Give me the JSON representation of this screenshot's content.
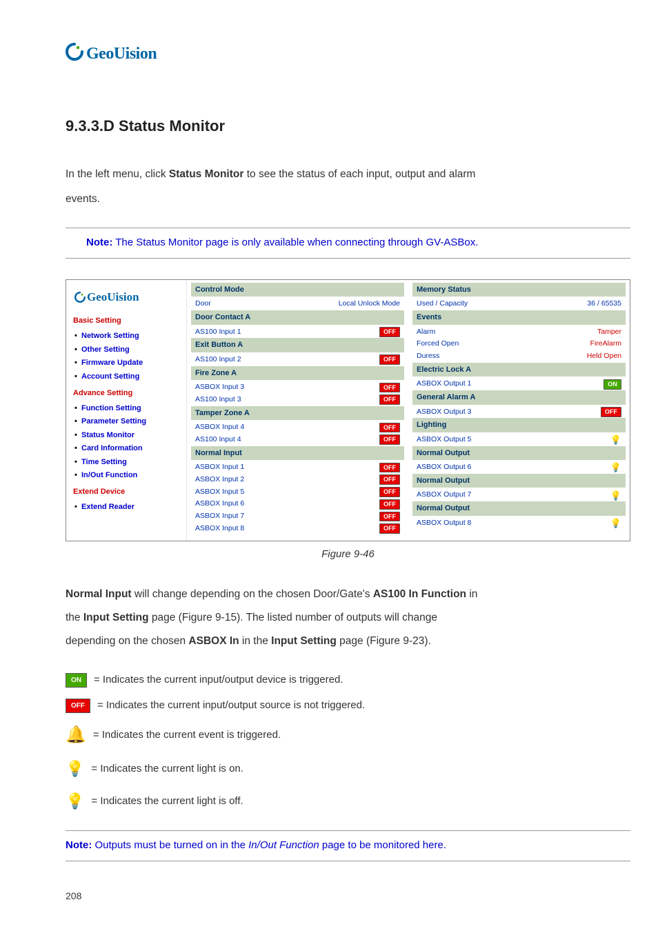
{
  "brand": "GeoUision",
  "section_title": "9.3.3.D  Status Monitor",
  "intro": {
    "t1": "In the left menu, click ",
    "b1": "Status Monitor",
    "t2": " to see the status of each input, output and alarm",
    "t3": "events."
  },
  "note1": {
    "b": "Note:",
    "body": " The Status Monitor page is only available when connecting through GV-ASBox."
  },
  "shot": {
    "brand": "GeoUision",
    "cats": {
      "basic": "Basic Setting",
      "advance": "Advance Setting",
      "extend": "Extend Device"
    },
    "menu_basic": [
      "Network Setting",
      "Other Setting",
      "Firmware Update",
      "Account Setting"
    ],
    "menu_adv": [
      "Function Setting",
      "Parameter Setting",
      "Status Monitor",
      "Card Information",
      "Time Setting",
      "In/Out Function"
    ],
    "menu_ext": [
      "Extend Reader"
    ],
    "left_col": {
      "h1": "Control Mode",
      "r1": {
        "k": "Door",
        "v": "Local Unlock Mode"
      },
      "h2": "Door Contact A",
      "r2": {
        "k": "AS100 Input 1",
        "v": "OFF"
      },
      "h3": "Exit Button A",
      "r3": {
        "k": "AS100 Input 2",
        "v": "OFF"
      },
      "h4": "Fire Zone A",
      "r4": {
        "k": "ASBOX Input 3",
        "v": "OFF"
      },
      "r5": {
        "k": "AS100 Input 3",
        "v": "OFF"
      },
      "h5": "Tamper Zone A",
      "r6": {
        "k": "ASBOX Input 4",
        "v": "OFF"
      },
      "r7": {
        "k": "AS100 Input 4",
        "v": "OFF"
      },
      "h6": "Normal Input",
      "r8": {
        "k": "ASBOX Input 1",
        "v": "OFF"
      },
      "r9": {
        "k": "ASBOX Input 2",
        "v": "OFF"
      },
      "r10": {
        "k": "ASBOX Input 5",
        "v": "OFF"
      },
      "r11": {
        "k": "ASBOX Input 6",
        "v": "OFF"
      },
      "r12": {
        "k": "ASBOX Input 7",
        "v": "OFF"
      },
      "r13": {
        "k": "ASBOX Input 8",
        "v": "OFF"
      }
    },
    "right_col": {
      "h1": "Memory Status",
      "r1": {
        "k": "Used / Capacity",
        "v": "36 / 65535"
      },
      "h2": "Events",
      "r2a": {
        "k": "Alarm",
        "v": "Tamper"
      },
      "r2b": {
        "k": "Forced Open",
        "v": "FireAlarm"
      },
      "r2c": {
        "k": "Duress",
        "v": "Held Open"
      },
      "h3": "Electric Lock A",
      "r3": {
        "k": "ASBOX Output 1",
        "v": "ON"
      },
      "h4": "General Alarm A",
      "r4": {
        "k": "ASBOX Output 3",
        "v": "OFF"
      },
      "h5": "Lighting",
      "r5": {
        "k": "ASBOX Output 5",
        "v": "bulb-on"
      },
      "h6": "Normal Output",
      "r6": {
        "k": "ASBOX Output 6",
        "v": "bulb-on"
      },
      "h7": "Normal Output",
      "r7": {
        "k": "ASBOX Output 7",
        "v": "bulb-on"
      },
      "h8": "Normal Output",
      "r8": {
        "k": "ASBOX Output 8",
        "v": "bulb-on"
      }
    }
  },
  "fig_caption": "Figure 9-46",
  "para2": {
    "t1a": "Normal Input",
    "t1b": " will change depending on the chosen Door/Gate's ",
    "t1c": "AS100 In Function",
    "t1d": " in",
    "t2a": "the ",
    "t2b": "Input Setting",
    "t2c": " page (Figure 9-15). The listed number of outputs will change",
    "t3a": "depending on the chosen ",
    "t3b": "ASBOX In",
    "t3c": " in the ",
    "t3d": "Input Setting",
    "t3e": " page (Figure 9-23)."
  },
  "legend": {
    "on": " = Indicates the current input/output device is triggered.",
    "off": " = Indicates the current input/output source is not triggered.",
    "alarm": " = Indicates the current event is triggered.",
    "bulb_on": " = Indicates the current light is on.",
    "bulb_off": " = Indicates the current light is off."
  },
  "note2": {
    "b": "Note:",
    "t1": " Outputs must be turned on in the ",
    "em": "In/Out Function",
    "t2": " page to be monitored here."
  },
  "badge": {
    "on": "ON",
    "off": "OFF"
  },
  "page": "208"
}
